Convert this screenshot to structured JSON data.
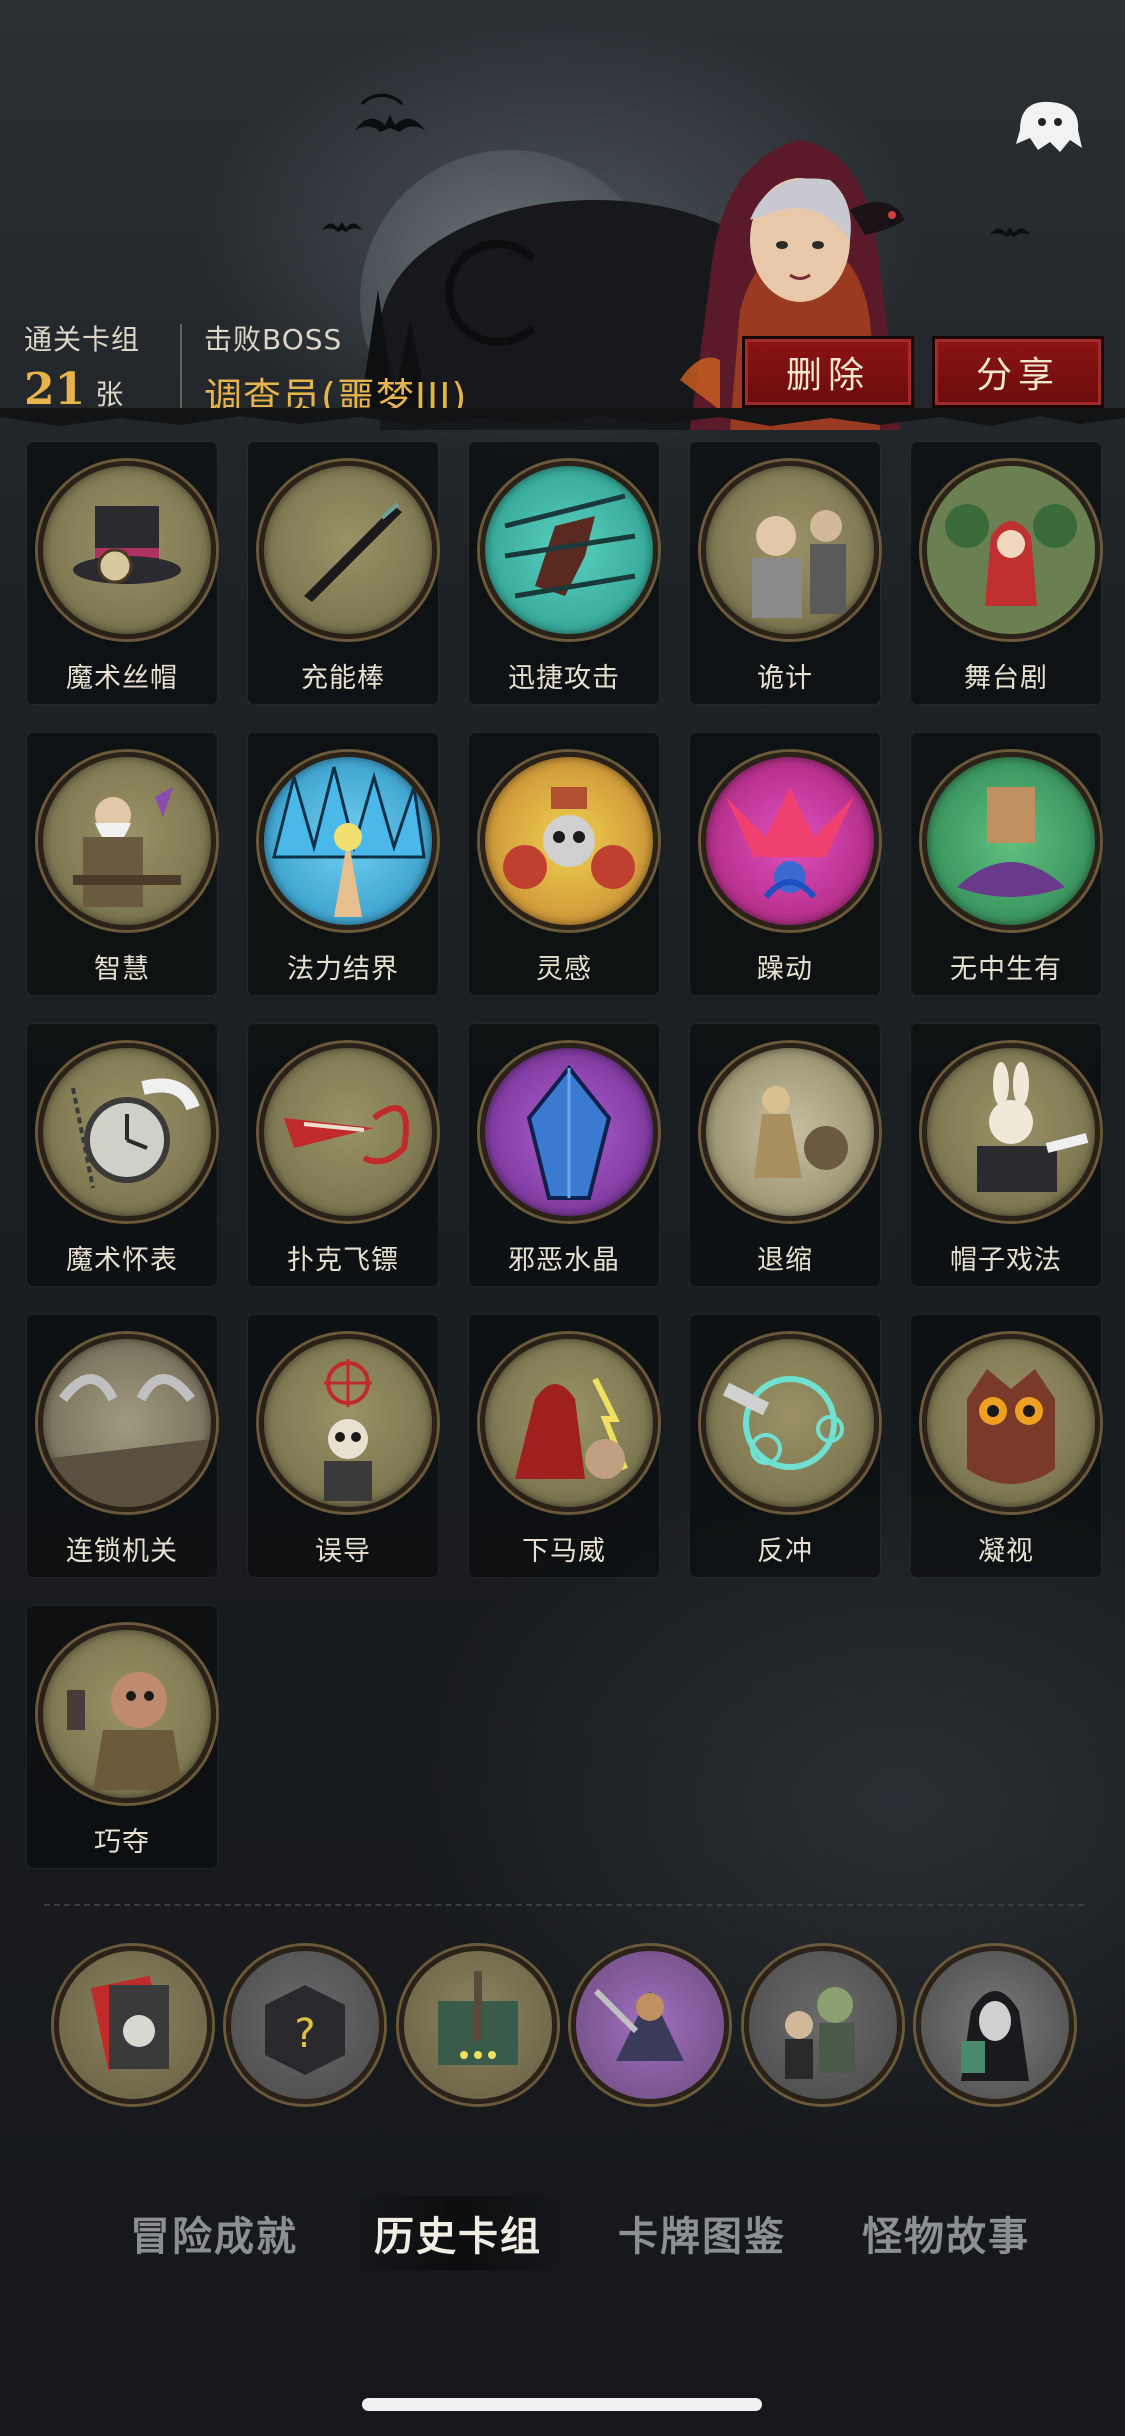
{
  "header": {
    "cleared_decks_label": "通关卡组",
    "cleared_decks_count": "21",
    "cleared_decks_unit": "张",
    "defeated_boss_label": "击败BOSS",
    "boss_name": "调查员(噩梦III)",
    "delete_button": "删除",
    "share_button": "分享"
  },
  "cards": [
    {
      "label": "魔术丝帽",
      "icon": "top-hat-icon"
    },
    {
      "label": "充能棒",
      "icon": "wand-icon"
    },
    {
      "label": "迅捷攻击",
      "icon": "swift-attack-icon"
    },
    {
      "label": "诡计",
      "icon": "trickery-icon"
    },
    {
      "label": "舞台剧",
      "icon": "stage-play-icon"
    },
    {
      "label": "智慧",
      "icon": "wisdom-icon"
    },
    {
      "label": "法力结界",
      "icon": "mana-barrier-icon"
    },
    {
      "label": "灵感",
      "icon": "inspiration-icon"
    },
    {
      "label": "躁动",
      "icon": "restless-icon"
    },
    {
      "label": "无中生有",
      "icon": "conjure-icon"
    },
    {
      "label": "魔术怀表",
      "icon": "pocket-watch-icon"
    },
    {
      "label": "扑克飞镖",
      "icon": "card-dart-icon"
    },
    {
      "label": "邪恶水晶",
      "icon": "evil-crystal-icon"
    },
    {
      "label": "退缩",
      "icon": "retreat-icon"
    },
    {
      "label": "帽子戏法",
      "icon": "hat-trick-icon"
    },
    {
      "label": "连锁机关",
      "icon": "chain-trap-icon"
    },
    {
      "label": "误导",
      "icon": "misdirect-icon"
    },
    {
      "label": "下马威",
      "icon": "intimidate-icon"
    },
    {
      "label": "反冲",
      "icon": "recoil-icon"
    },
    {
      "label": "凝视",
      "icon": "gaze-icon"
    },
    {
      "label": "巧夺",
      "icon": "snatch-icon"
    }
  ],
  "bottom_icons": [
    {
      "name": "card-skull-icon"
    },
    {
      "name": "mystery-box-icon"
    },
    {
      "name": "sword-banner-icon"
    },
    {
      "name": "warrior-icon"
    },
    {
      "name": "zombie-icon"
    },
    {
      "name": "hooded-figure-icon"
    }
  ],
  "tabs": [
    {
      "label": "冒险成就",
      "active": false
    },
    {
      "label": "历史卡组",
      "active": true
    },
    {
      "label": "卡牌图鉴",
      "active": false
    },
    {
      "label": "怪物故事",
      "active": false
    }
  ],
  "colors": {
    "accent_gold": "#e6b34c",
    "button_red": "#8e1414",
    "background": "#1e2225"
  }
}
